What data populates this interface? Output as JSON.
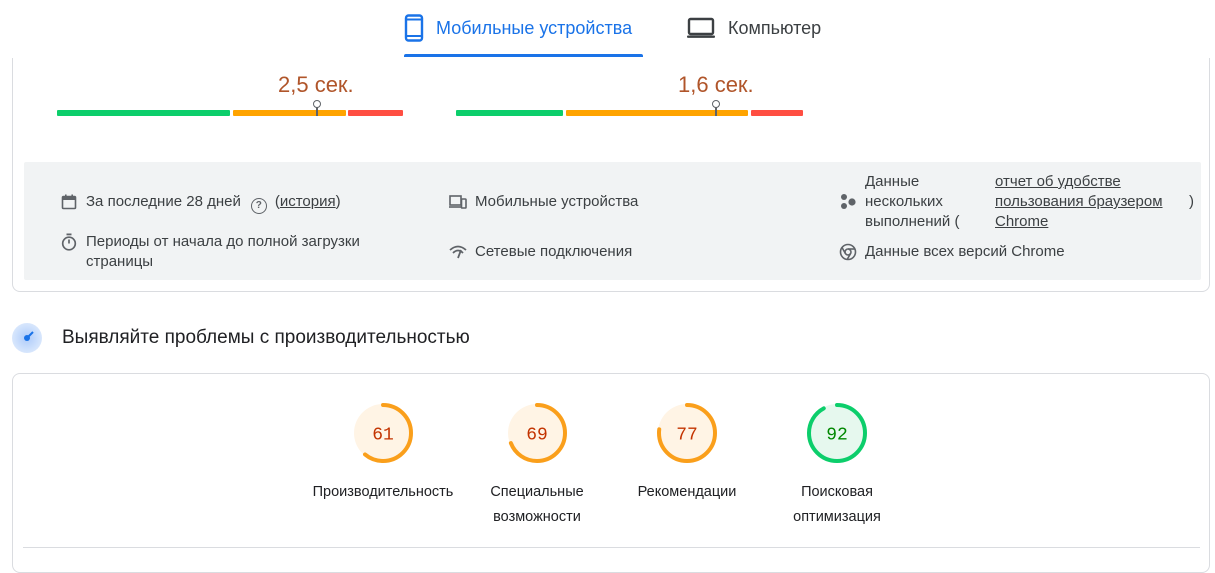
{
  "tabs": [
    {
      "label": "Мобильные устройства",
      "icon": "smartphone-icon",
      "active": true
    },
    {
      "label": "Компьютер",
      "icon": "laptop-icon",
      "active": false
    }
  ],
  "metrics": [
    {
      "value_text": "2,5 сек.",
      "segments": [
        0.5,
        0.33,
        0.17
      ]
    },
    {
      "value_text": "1,6 сек.",
      "segments": [
        0.32,
        0.53,
        0.15
      ]
    }
  ],
  "info": {
    "period": "За последние 28 дней",
    "history_open": "(",
    "history_link": "история",
    "history_close": ")",
    "period_desc": "Периоды от начала до полной загрузки страницы",
    "devices": "Мобильные устройства",
    "network": "Сетевые подключения",
    "multi_runs": "Данные нескольких выполнений (",
    "report_link": "отчет об удобстве пользования браузером Chrome",
    "report_close": ")",
    "all_versions": "Данные всех версий Chrome"
  },
  "section": {
    "title": "Выявляйте проблемы с производительностью",
    "icon": "radar-icon"
  },
  "scores": [
    {
      "value": "61",
      "label": "Производительность",
      "fraction": 0.61,
      "color": "#fa9f1b",
      "bg": "#fff4e5",
      "text_color": "#c33300"
    },
    {
      "value": "69",
      "label": "Специальные возможности",
      "fraction": 0.69,
      "color": "#fa9f1b",
      "bg": "#fff4e5",
      "text_color": "#c33300"
    },
    {
      "value": "77",
      "label": "Рекомендации",
      "fraction": 0.77,
      "color": "#fa9f1b",
      "bg": "#fff4e5",
      "text_color": "#c33300"
    },
    {
      "value": "92",
      "label": "Поисковая оптимизация",
      "fraction": 0.92,
      "color": "#0cce6b",
      "bg": "#e6f8ee",
      "text_color": "#008800"
    }
  ],
  "colors": {
    "accent": "#1a73e8",
    "good": "#0cce6b",
    "average": "#ffa400",
    "poor": "#ff4e42",
    "metric_text": "#b0552a"
  }
}
